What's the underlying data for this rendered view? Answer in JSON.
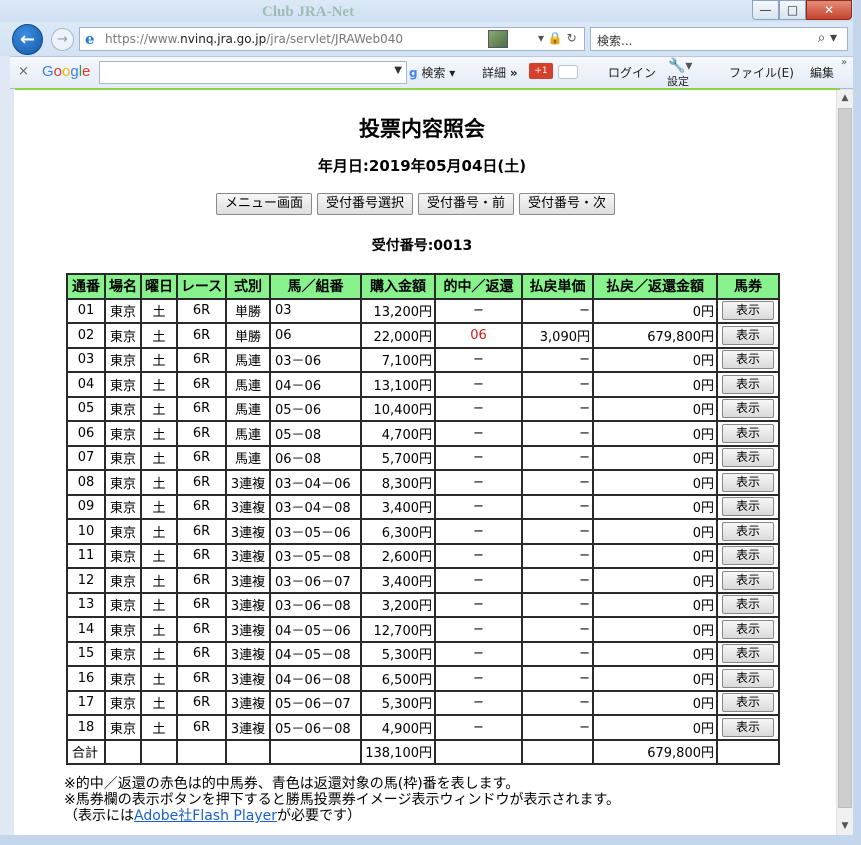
{
  "browser": {
    "bg_title": "Club JRA-Net",
    "url_prefix": "https://www.",
    "url_host": "nvinq.jra.go.jp",
    "url_path": "/jra/servlet/JRAWeb040",
    "search_placeholder": "検索...",
    "window_buttons": {
      "minimize": "—",
      "maximize": "□",
      "close": "✕"
    },
    "icons": {
      "back": "back-arrow-icon",
      "forward": "forward-arrow-icon",
      "ie": "ie-logo-icon",
      "lock": "lock-icon",
      "refresh": "refresh-icon",
      "search": "search-icon"
    }
  },
  "toolbar": {
    "close": "×",
    "google": [
      "G",
      "o",
      "o",
      "g",
      "l",
      "e"
    ],
    "search_label": "検索",
    "detail_label": "詳細",
    "detail_arrows": "»",
    "gplus_label": "+1",
    "login_label": "ログイン",
    "settings_label": "設定",
    "file_menu": "ファイル(E)",
    "edit_menu": "編集",
    "more": "»",
    "accent_color": "#8ed14c"
  },
  "page": {
    "title": "投票内容照会",
    "date_line": "年月日:2019年05月04日(土)",
    "buttons": [
      "メニュー画面",
      "受付番号選択",
      "受付番号・前",
      "受付番号・次"
    ],
    "receipt_line": "受付番号:0013"
  },
  "table": {
    "headers": [
      "通番",
      "場名",
      "曜日",
      "レース",
      "式別",
      "馬／組番",
      "購入金額",
      "的中／返還",
      "払戻単価",
      "払戻／返還金額",
      "馬券"
    ],
    "header_color": "#88f28c",
    "hit_color": "#d21a1a",
    "show_label": "表示",
    "rows": [
      {
        "no": "01",
        "place": "東京",
        "day": "土",
        "race": "6R",
        "type": "単勝",
        "combo": "03",
        "amount": "13,200円",
        "hit": "−",
        "unit": "−",
        "payout": "0円"
      },
      {
        "no": "02",
        "place": "東京",
        "day": "土",
        "race": "6R",
        "type": "単勝",
        "combo": "06",
        "amount": "22,000円",
        "hit": "06",
        "unit": "3,090円",
        "payout": "679,800円"
      },
      {
        "no": "03",
        "place": "東京",
        "day": "土",
        "race": "6R",
        "type": "馬連",
        "combo": "03－06",
        "amount": "7,100円",
        "hit": "−",
        "unit": "−",
        "payout": "0円"
      },
      {
        "no": "04",
        "place": "東京",
        "day": "土",
        "race": "6R",
        "type": "馬連",
        "combo": "04－06",
        "amount": "13,100円",
        "hit": "−",
        "unit": "−",
        "payout": "0円"
      },
      {
        "no": "05",
        "place": "東京",
        "day": "土",
        "race": "6R",
        "type": "馬連",
        "combo": "05－06",
        "amount": "10,400円",
        "hit": "−",
        "unit": "−",
        "payout": "0円"
      },
      {
        "no": "06",
        "place": "東京",
        "day": "土",
        "race": "6R",
        "type": "馬連",
        "combo": "05－08",
        "amount": "4,700円",
        "hit": "−",
        "unit": "−",
        "payout": "0円"
      },
      {
        "no": "07",
        "place": "東京",
        "day": "土",
        "race": "6R",
        "type": "馬連",
        "combo": "06－08",
        "amount": "5,700円",
        "hit": "−",
        "unit": "−",
        "payout": "0円"
      },
      {
        "no": "08",
        "place": "東京",
        "day": "土",
        "race": "6R",
        "type": "3連複",
        "combo": "03－04－06",
        "amount": "8,300円",
        "hit": "−",
        "unit": "−",
        "payout": "0円"
      },
      {
        "no": "09",
        "place": "東京",
        "day": "土",
        "race": "6R",
        "type": "3連複",
        "combo": "03－04－08",
        "amount": "3,400円",
        "hit": "−",
        "unit": "−",
        "payout": "0円"
      },
      {
        "no": "10",
        "place": "東京",
        "day": "土",
        "race": "6R",
        "type": "3連複",
        "combo": "03－05－06",
        "amount": "6,300円",
        "hit": "−",
        "unit": "−",
        "payout": "0円"
      },
      {
        "no": "11",
        "place": "東京",
        "day": "土",
        "race": "6R",
        "type": "3連複",
        "combo": "03－05－08",
        "amount": "2,600円",
        "hit": "−",
        "unit": "−",
        "payout": "0円"
      },
      {
        "no": "12",
        "place": "東京",
        "day": "土",
        "race": "6R",
        "type": "3連複",
        "combo": "03－06－07",
        "amount": "3,400円",
        "hit": "−",
        "unit": "−",
        "payout": "0円"
      },
      {
        "no": "13",
        "place": "東京",
        "day": "土",
        "race": "6R",
        "type": "3連複",
        "combo": "03－06－08",
        "amount": "3,200円",
        "hit": "−",
        "unit": "−",
        "payout": "0円"
      },
      {
        "no": "14",
        "place": "東京",
        "day": "土",
        "race": "6R",
        "type": "3連複",
        "combo": "04－05－06",
        "amount": "12,700円",
        "hit": "−",
        "unit": "−",
        "payout": "0円"
      },
      {
        "no": "15",
        "place": "東京",
        "day": "土",
        "race": "6R",
        "type": "3連複",
        "combo": "04－05－08",
        "amount": "5,300円",
        "hit": "−",
        "unit": "−",
        "payout": "0円"
      },
      {
        "no": "16",
        "place": "東京",
        "day": "土",
        "race": "6R",
        "type": "3連複",
        "combo": "04－06－08",
        "amount": "6,500円",
        "hit": "−",
        "unit": "−",
        "payout": "0円"
      },
      {
        "no": "17",
        "place": "東京",
        "day": "土",
        "race": "6R",
        "type": "3連複",
        "combo": "05－06－07",
        "amount": "5,300円",
        "hit": "−",
        "unit": "−",
        "payout": "0円"
      },
      {
        "no": "18",
        "place": "東京",
        "day": "土",
        "race": "6R",
        "type": "3連複",
        "combo": "05－06－08",
        "amount": "4,900円",
        "hit": "−",
        "unit": "−",
        "payout": "0円"
      }
    ],
    "total": {
      "label": "合計",
      "amount": "138,100円",
      "payout": "679,800円"
    }
  },
  "notes": {
    "line1": "※的中／返還の赤色は的中馬券、青色は返還対象の馬(枠)番を表します。",
    "line2": "※馬券欄の表示ボタンを押下すると勝馬投票券イメージ表示ウィンドウが表示されます。",
    "line3_prefix": "（表示には",
    "line3_link": "Adobe社Flash Player",
    "line3_suffix": "が必要です）"
  }
}
